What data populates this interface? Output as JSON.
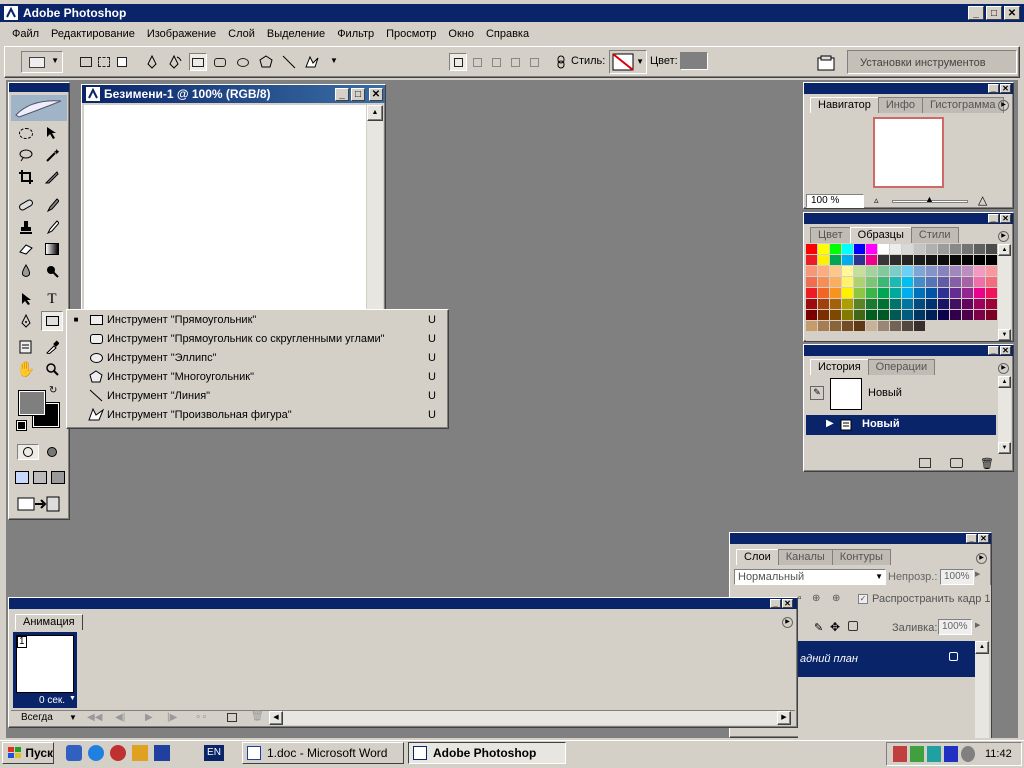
{
  "app": {
    "title": "Adobe Photoshop"
  },
  "menu": [
    {
      "label": "Файл"
    },
    {
      "label": "Редактирование"
    },
    {
      "label": "Изображение"
    },
    {
      "label": "Слой"
    },
    {
      "label": "Выделение"
    },
    {
      "label": "Фильтр"
    },
    {
      "label": "Просмотр"
    },
    {
      "label": "Окно"
    },
    {
      "label": "Справка"
    }
  ],
  "options_bar": {
    "style_label": "Стиль:",
    "color_label": "Цвет:",
    "color": "#808080",
    "tool_presets": "Установки инструментов"
  },
  "document": {
    "title": "Безимени-1 @ 100% (RGB/8)"
  },
  "shape_flyout": {
    "items": [
      {
        "label": "Инструмент \"Прямоугольник\"",
        "key": "U",
        "selected": true,
        "icon": "rectangle-icon"
      },
      {
        "label": "Инструмент \"Прямоугольник со скругленными углами\"",
        "key": "U",
        "selected": false,
        "icon": "rounded-rectangle-icon"
      },
      {
        "label": "Инструмент \"Эллипс\"",
        "key": "U",
        "selected": false,
        "icon": "ellipse-icon"
      },
      {
        "label": "Инструмент \"Многоугольник\"",
        "key": "U",
        "selected": false,
        "icon": "polygon-icon"
      },
      {
        "label": "Инструмент \"Линия\"",
        "key": "U",
        "selected": false,
        "icon": "line-icon"
      },
      {
        "label": "Инструмент \"Произвольная фигура\"",
        "key": "U",
        "selected": false,
        "icon": "custom-shape-icon"
      }
    ]
  },
  "navigator": {
    "tabs": [
      "Навигатор",
      "Инфо",
      "Гистограмма"
    ],
    "zoom": "100 %"
  },
  "swatches_panel": {
    "tabs": [
      "Цвет",
      "Образцы",
      "Стили"
    ]
  },
  "history": {
    "tabs": [
      "История",
      "Операции"
    ],
    "snapshot_label": "Новый",
    "step_label": "Новый"
  },
  "layers": {
    "tabs": [
      "Слои",
      "Каналы",
      "Контуры"
    ],
    "blend_mode": "Нормальный",
    "opacity_label": "Непрозр.:",
    "opacity": "100%",
    "propagate_label": "Распространить кадр 1",
    "fill_label": "Заливка:",
    "fill": "100%",
    "layer_name": "адний план"
  },
  "animation": {
    "tab": "Анимация",
    "frame_number": "1",
    "frame_delay": "0 сек.",
    "loop": "Всегда"
  },
  "colors": {
    "foreground": "#7f7f7f",
    "background": "#000000",
    "title_active": "#0a246a",
    "workspace": "#808080"
  },
  "taskbar": {
    "start_label": "Пуск",
    "lang": "EN",
    "tasks": [
      {
        "label": "1.doc - Microsoft Word"
      },
      {
        "label": "Adobe Photoshop"
      }
    ],
    "clock": "11:42"
  }
}
